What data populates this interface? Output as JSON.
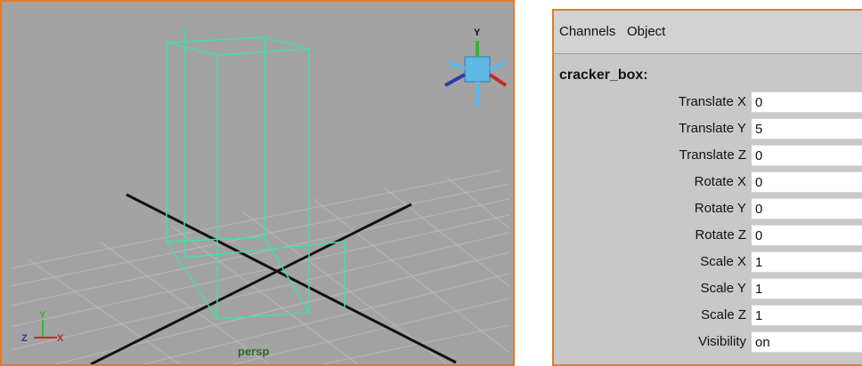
{
  "viewport": {
    "camera_label": "persp",
    "view_cube_label": "Y",
    "axis_indicator": {
      "y": "Y",
      "z": "Z",
      "x": "X"
    }
  },
  "channel_box": {
    "menus": [
      "Channels",
      "Object"
    ],
    "object_name": "cracker_box:",
    "attributes": [
      {
        "label": "Translate X",
        "value": "0"
      },
      {
        "label": "Translate Y",
        "value": "5"
      },
      {
        "label": "Translate Z",
        "value": "0"
      },
      {
        "label": "Rotate X",
        "value": "0"
      },
      {
        "label": "Rotate Y",
        "value": "0"
      },
      {
        "label": "Rotate Z",
        "value": "0"
      },
      {
        "label": "Scale X",
        "value": "1"
      },
      {
        "label": "Scale Y",
        "value": "1"
      },
      {
        "label": "Scale Z",
        "value": "1"
      },
      {
        "label": "Visibility",
        "value": "on"
      }
    ]
  },
  "colors": {
    "panel_border": "#e07a2e",
    "viewport_bg": "#a3a3a3",
    "wireframe": "#44e0a0",
    "channel_bg": "#c8c8c8"
  }
}
